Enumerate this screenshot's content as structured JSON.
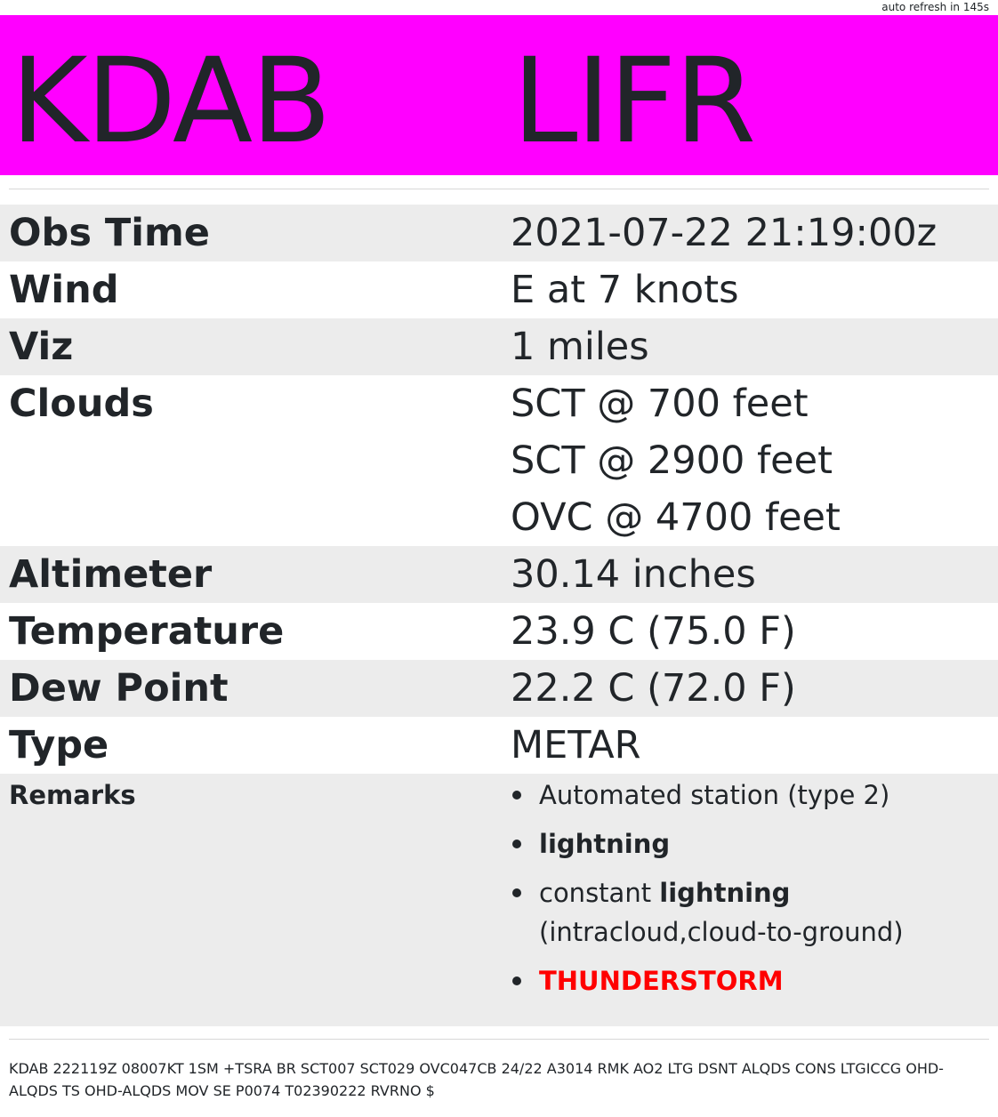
{
  "refresh_text": "auto refresh in 145s",
  "banner": {
    "station": "KDAB",
    "flight_category": "LIFR",
    "color": "#ff00ff"
  },
  "rows": {
    "obs_time": {
      "label": "Obs Time",
      "value": "2021-07-22 21:19:00z"
    },
    "wind": {
      "label": "Wind",
      "value": "E at 7 knots"
    },
    "viz": {
      "label": "Viz",
      "value": "1 miles"
    },
    "clouds": {
      "label": "Clouds",
      "values": [
        "SCT @ 700 feet",
        "SCT @ 2900 feet",
        "OVC @ 4700 feet"
      ]
    },
    "altimeter": {
      "label": "Altimeter",
      "value": "30.14 inches"
    },
    "temperature": {
      "label": "Temperature",
      "value": "23.9 C (75.0 F)"
    },
    "dew_point": {
      "label": "Dew Point",
      "value": "22.2 C (72.0 F)"
    },
    "type": {
      "label": "Type",
      "value": "METAR"
    }
  },
  "remarks": {
    "label": "Remarks",
    "items": {
      "automated": "Automated station (type 2)",
      "lightning": "lightning",
      "constant_prefix": "constant",
      "constant_bold": "lightning",
      "constant_detail": "(intracloud,cloud-to-ground)",
      "thunderstorm": "THUNDERSTORM"
    }
  },
  "raw_metar": "KDAB 222119Z 08007KT 1SM +TSRA BR SCT007 SCT029 OVC047CB 24/22 A3014 RMK AO2 LTG DSNT ALQDS CONS LTGICCG OHD-ALQDS TS OHD-ALQDS MOV SE P0074 T02390222 RVRNO $"
}
